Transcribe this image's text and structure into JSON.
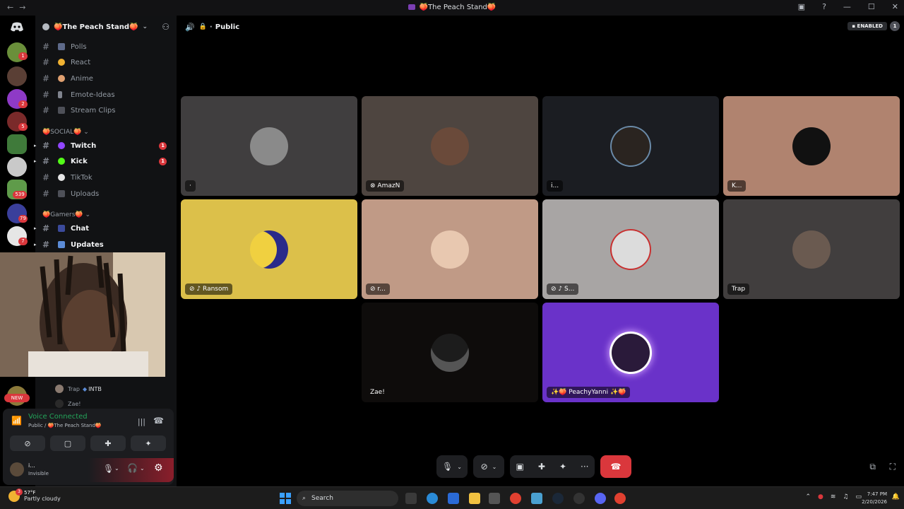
{
  "window": {
    "title": "🍑The Peach Stand🍑",
    "nav_back": "←",
    "nav_forward": "→"
  },
  "server_list": {
    "badges": [
      "1",
      "2",
      "5",
      "539",
      "79",
      "7"
    ],
    "new_label": "NEW"
  },
  "sidebar": {
    "server_name": "🍑The Peach Stand🍑",
    "channels": [
      {
        "name": "Polls"
      },
      {
        "name": "React"
      },
      {
        "name": "Anime"
      },
      {
        "name": "Emote-Ideas"
      },
      {
        "name": "Stream Clips"
      }
    ],
    "category_social": "🍑SOCIAL🍑",
    "social_channels": [
      {
        "name": "Twitch",
        "badge": "1"
      },
      {
        "name": "Kick",
        "badge": "1"
      },
      {
        "name": "TikTok"
      },
      {
        "name": "Uploads"
      }
    ],
    "category_gamers": "🍑Gamers🍑",
    "gamer_channels": [
      {
        "name": "Chat"
      },
      {
        "name": "Updates"
      }
    ],
    "voice_members": [
      {
        "name": "Trap",
        "tag": "INTB"
      },
      {
        "name": "Zae!"
      }
    ]
  },
  "voice_panel": {
    "status": "Voice Connected",
    "location": "Public / 🍑The Peach Stand🍑"
  },
  "user_panel": {
    "username": "i...",
    "status": "Invisible"
  },
  "header": {
    "channel_name": "Public",
    "enabled_badge": "ENABLED",
    "notif_count": "1"
  },
  "tiles": [
    {
      "label": "·"
    },
    {
      "label": "AmazN"
    },
    {
      "label": "i..."
    },
    {
      "label": "K..."
    },
    {
      "label": "Ransom"
    },
    {
      "label": "r..."
    },
    {
      "label": "S..."
    },
    {
      "label": "Trap"
    },
    {
      "label": "Zae!"
    },
    {
      "label": "✨🍑 PeachyYanni ✨🍑"
    }
  ],
  "taskbar": {
    "weather_temp": "57°F",
    "weather_desc": "Partly cloudy",
    "search_placeholder": "Search",
    "weather_badge": "3",
    "clock_time": "7:47 PM",
    "clock_date": "2/20/2026"
  },
  "colors": {
    "accent_red": "#da373c",
    "voice_green": "#23a55a",
    "tile_yellow": "#dcc04a",
    "tile_purple": "#6a32c9"
  }
}
